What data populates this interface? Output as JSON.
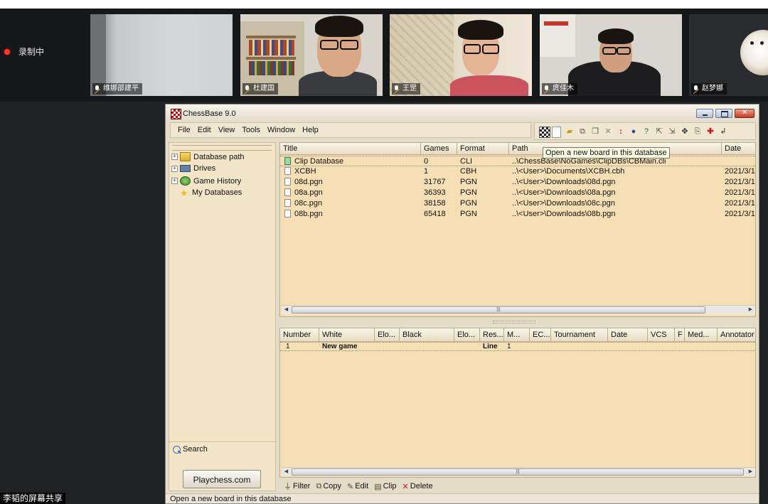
{
  "meeting": {
    "recording_label": "录制中",
    "participants": [
      {
        "name": "维娜邵建平"
      },
      {
        "name": "杜建国"
      },
      {
        "name": "王罡"
      },
      {
        "name": "庹佳木"
      },
      {
        "name": "赵梦娜"
      }
    ],
    "screen_share_label": "李韬的屏幕共享"
  },
  "window": {
    "title": "ChessBase 9.0",
    "menu": [
      "File",
      "Edit",
      "View",
      "Tools",
      "Window",
      "Help"
    ],
    "toolbar_icons": [
      "new-board-icon",
      "blank-icon",
      "open-folder-icon",
      "copy-db-icon",
      "paste-db-icon",
      "close-x-icon",
      "sort-icon",
      "properties-icon",
      "help-icon",
      "export-icon",
      "import-icon",
      "move-icon",
      "clip-icon",
      "plus-icon",
      "back-icon"
    ],
    "tooltip": "Open a new board in this database",
    "status_text": "Open a new board in this database"
  },
  "tree": {
    "items": [
      {
        "label": "Database path",
        "icon": "folder-icon",
        "expandable": true
      },
      {
        "label": "Drives",
        "icon": "drives-icon",
        "expandable": true
      },
      {
        "label": "Game History",
        "icon": "history-icon",
        "expandable": true
      },
      {
        "label": "My Databases",
        "icon": "star-icon",
        "expandable": false
      }
    ],
    "search_label": "Search",
    "playchess_label": "Playchess.com"
  },
  "databases": {
    "columns": [
      "Title",
      "Games",
      "Format",
      "Path",
      "Date"
    ],
    "rows": [
      {
        "title": "Clip Database",
        "games": "0",
        "format": "CLI",
        "path": "..\\ChessBase\\NoGames\\ClipDBs\\CBMain.cli",
        "date": ""
      },
      {
        "title": "XCBH",
        "games": "1",
        "format": "CBH",
        "path": "..\\<User>\\Documents\\XCBH.cbh",
        "date": "2021/3/1"
      },
      {
        "title": "08d.pgn",
        "games": "31767",
        "format": "PGN",
        "path": "..\\<User>\\Downloads\\08d.pgn",
        "date": "2021/3/1"
      },
      {
        "title": "08a.pgn",
        "games": "36393",
        "format": "PGN",
        "path": "..\\<User>\\Downloads\\08a.pgn",
        "date": "2021/3/1"
      },
      {
        "title": "08c.pgn",
        "games": "38158",
        "format": "PGN",
        "path": "..\\<User>\\Downloads\\08c.pgn",
        "date": "2021/3/1"
      },
      {
        "title": "08b.pgn",
        "games": "65418",
        "format": "PGN",
        "path": "..\\<User>\\Downloads\\08b.pgn",
        "date": "2021/3/1"
      }
    ]
  },
  "games": {
    "columns": [
      "Number",
      "White",
      "Elo...",
      "Black",
      "Elo...",
      "Res...",
      "M...",
      "EC...",
      "Tournament",
      "Date",
      "VCS",
      "F",
      "Med...",
      "Annotator"
    ],
    "rows": [
      {
        "number": "1",
        "white": "New game",
        "result": "Line",
        "moves": "1"
      }
    ]
  },
  "bottom_actions": [
    {
      "label": "Filter",
      "icon": "filter-icon"
    },
    {
      "label": "Copy",
      "icon": "copy-icon"
    },
    {
      "label": "Edit",
      "icon": "edit-icon"
    },
    {
      "label": "Clip",
      "icon": "clip-icon"
    },
    {
      "label": "Delete",
      "icon": "delete-icon"
    }
  ]
}
